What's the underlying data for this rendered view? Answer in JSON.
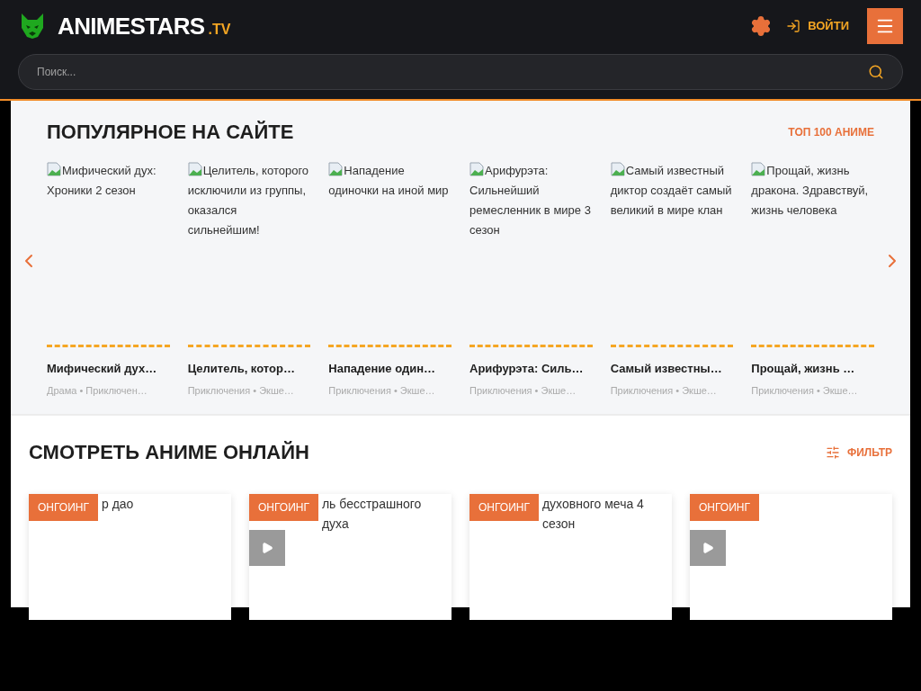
{
  "header": {
    "logo_text": "ANIMESTARS",
    "logo_suffix": ".TV",
    "login": "ВОЙТИ",
    "search": {
      "placeholder": "Поиск..."
    }
  },
  "popular": {
    "title": "ПОПУЛЯРНОЕ НА САЙТЕ",
    "link": "ТОП 100 АНИМЕ",
    "items": [
      {
        "alt": "Мифический дух: Хроники 2 сезон",
        "title": "Мифический дух…",
        "genres": "Драма • Приключен…"
      },
      {
        "alt": "Целитель, которого исключили из группы, оказался сильнейшим!",
        "title": "Целитель, котор…",
        "genres": "Приключения • Экше…"
      },
      {
        "alt": "Нападение одиночки на иной мир",
        "title": "Нападение один…",
        "genres": "Приключения • Экше…"
      },
      {
        "alt": "Арифурэта: Сильнейший ремесленник в мире 3 сезон",
        "title": "Арифурэта: Силь…",
        "genres": "Приключения • Экше…"
      },
      {
        "alt": "Самый известный диктор создаёт самый великий в мире клан",
        "title": "Самый известны…",
        "genres": "Приключения • Экше…"
      },
      {
        "alt": "Прощай, жизнь дракона. Здравствуй, жизнь человека",
        "title": "Прощай, жизнь …",
        "genres": "Приключения • Экше…"
      }
    ]
  },
  "catalog": {
    "title": "СМОТРЕТЬ АНИМЕ ОНЛАЙН",
    "filter": "ФИЛЬТР",
    "cards": [
      {
        "badge": "ОНГОИНГ",
        "alt": "р дао",
        "play": false
      },
      {
        "badge": "ОНГОИНГ",
        "alt": "ль бесстрашного духа",
        "play": true
      },
      {
        "badge": "ОНГОИНГ",
        "alt": "духовного меча 4 сезон",
        "play": false
      },
      {
        "badge": "ОНГОИНГ",
        "play": true
      }
    ]
  }
}
